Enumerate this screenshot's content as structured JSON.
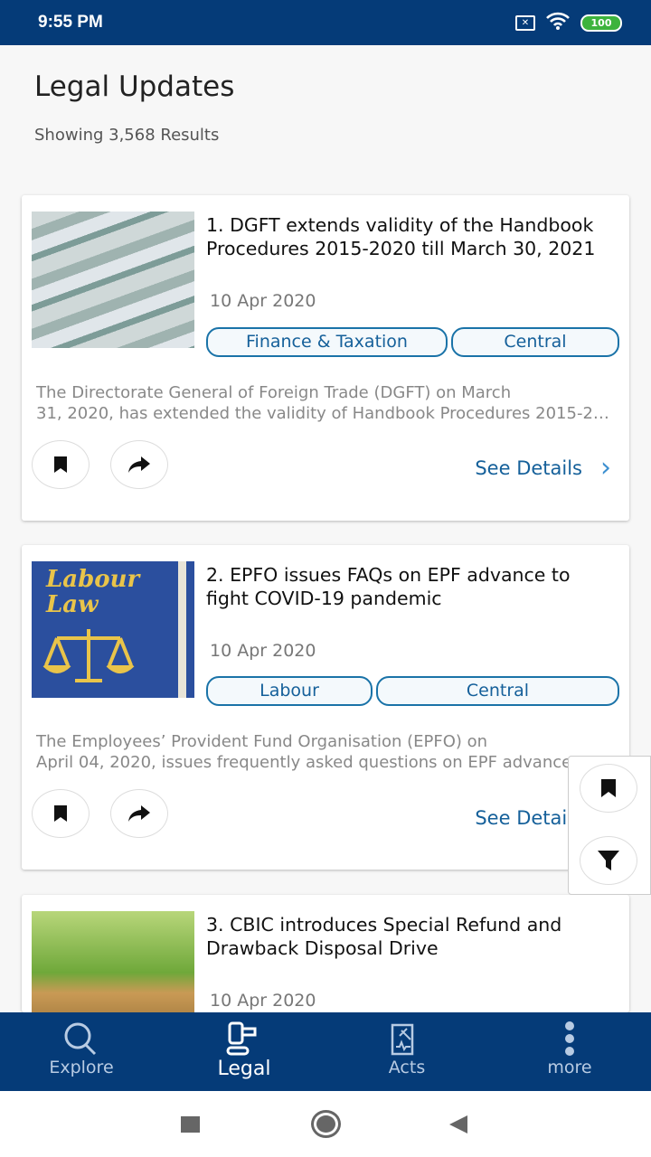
{
  "status_bar": {
    "time": "9:55 PM",
    "battery": "100"
  },
  "header": {
    "title": "Legal Updates",
    "results": "Showing 3,568 Results"
  },
  "cards": [
    {
      "title": "1. DGFT extends validity of the Handbook Procedures 2015-2020 till March 30, 2021",
      "date": "10 Apr 2020",
      "tags": [
        "Finance & Taxation",
        "Central"
      ],
      "desc": [
        "The Directorate General of Foreign Trade (DGFT) on March",
        "31, 2020, has extended the validity of Handbook Procedures 2015-2020"
      ],
      "see": "See Details"
    },
    {
      "title": "2. EPFO issues FAQs on EPF advance to fight COVID-19 pandemic",
      "date": "10 Apr 2020",
      "tags": [
        "Labour",
        "Central"
      ],
      "desc": [
        "The Employees’ Provident Fund Organisation (EPFO) on",
        "April 04, 2020, issues frequently asked questions on EPF advance"
      ],
      "see": "See Details",
      "image_text": "Labour Law"
    },
    {
      "title": "3. CBIC introduces Special Refund and Drawback Disposal Drive",
      "date": "10 Apr 2020"
    }
  ],
  "nav": [
    {
      "label": "Explore"
    },
    {
      "label": "Legal"
    },
    {
      "label": "Acts"
    },
    {
      "label": "more"
    }
  ],
  "colors": {
    "primary": "#053b78",
    "tag": "#1a73a8",
    "link": "#15609a"
  }
}
